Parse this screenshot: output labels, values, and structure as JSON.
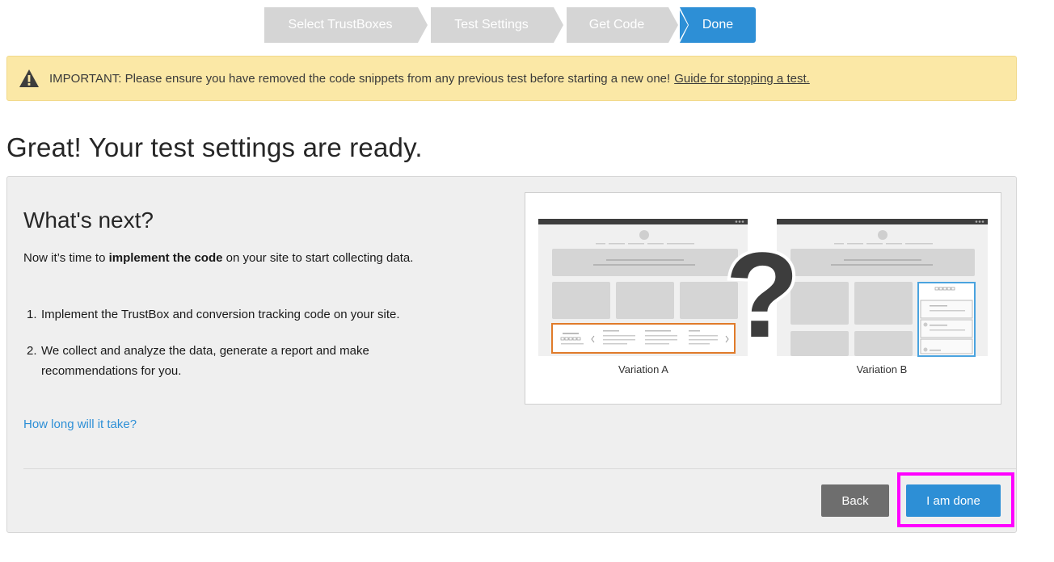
{
  "stepper": {
    "steps": [
      {
        "label": "Select TrustBoxes",
        "state": "inactive"
      },
      {
        "label": "Test Settings",
        "state": "inactive"
      },
      {
        "label": "Get Code",
        "state": "inactive"
      },
      {
        "label": "Done",
        "state": "active"
      }
    ]
  },
  "alert": {
    "icon": "warning-triangle-icon",
    "message": "IMPORTANT: Please ensure you have removed the code snippets from any previous test before starting a new one!",
    "link_label": "Guide for stopping a test."
  },
  "page": {
    "title": "Great! Your test settings are ready."
  },
  "panel": {
    "heading": "What's next?",
    "intro_before": "Now it’s time to ",
    "intro_bold": "implement the code",
    "intro_after": " on your site to start collecting data.",
    "steps": [
      {
        "num": "1.",
        "text": "Implement the TrustBox and conversion tracking code on your site."
      },
      {
        "num": "2.",
        "text": "We collect and analyze the data, generate a report and make recommendations for you."
      }
    ],
    "link_how_long": "How long will it take?",
    "illustration": {
      "variation_a": "Variation A",
      "variation_b": "Variation B",
      "glyph": "?"
    }
  },
  "buttons": {
    "back": "Back",
    "done": "I am done"
  },
  "colors": {
    "accent": "#2d8fd6",
    "step_inactive": "#d5d5d5",
    "alert_bg": "#fbe8a6",
    "highlight": "#ff00ff",
    "variation_a_border": "#e07b2a",
    "variation_b_border": "#4aa3df"
  }
}
